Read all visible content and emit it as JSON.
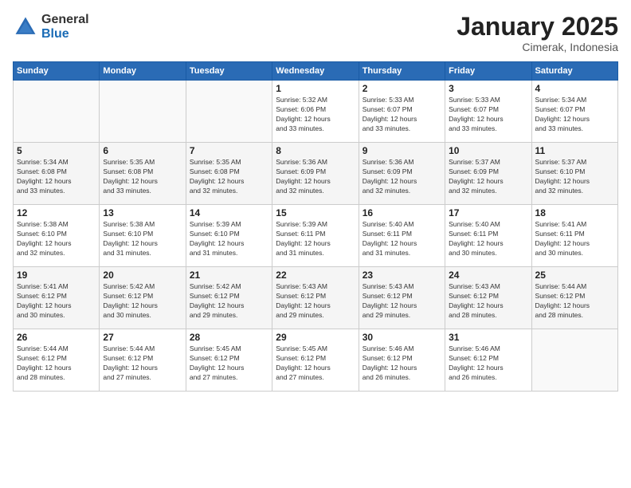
{
  "header": {
    "logo_general": "General",
    "logo_blue": "Blue",
    "month_title": "January 2025",
    "location": "Cimerak, Indonesia"
  },
  "weekdays": [
    "Sunday",
    "Monday",
    "Tuesday",
    "Wednesday",
    "Thursday",
    "Friday",
    "Saturday"
  ],
  "weeks": [
    [
      {
        "day": "",
        "info": ""
      },
      {
        "day": "",
        "info": ""
      },
      {
        "day": "",
        "info": ""
      },
      {
        "day": "1",
        "info": "Sunrise: 5:32 AM\nSunset: 6:06 PM\nDaylight: 12 hours\nand 33 minutes."
      },
      {
        "day": "2",
        "info": "Sunrise: 5:33 AM\nSunset: 6:07 PM\nDaylight: 12 hours\nand 33 minutes."
      },
      {
        "day": "3",
        "info": "Sunrise: 5:33 AM\nSunset: 6:07 PM\nDaylight: 12 hours\nand 33 minutes."
      },
      {
        "day": "4",
        "info": "Sunrise: 5:34 AM\nSunset: 6:07 PM\nDaylight: 12 hours\nand 33 minutes."
      }
    ],
    [
      {
        "day": "5",
        "info": "Sunrise: 5:34 AM\nSunset: 6:08 PM\nDaylight: 12 hours\nand 33 minutes."
      },
      {
        "day": "6",
        "info": "Sunrise: 5:35 AM\nSunset: 6:08 PM\nDaylight: 12 hours\nand 33 minutes."
      },
      {
        "day": "7",
        "info": "Sunrise: 5:35 AM\nSunset: 6:08 PM\nDaylight: 12 hours\nand 32 minutes."
      },
      {
        "day": "8",
        "info": "Sunrise: 5:36 AM\nSunset: 6:09 PM\nDaylight: 12 hours\nand 32 minutes."
      },
      {
        "day": "9",
        "info": "Sunrise: 5:36 AM\nSunset: 6:09 PM\nDaylight: 12 hours\nand 32 minutes."
      },
      {
        "day": "10",
        "info": "Sunrise: 5:37 AM\nSunset: 6:09 PM\nDaylight: 12 hours\nand 32 minutes."
      },
      {
        "day": "11",
        "info": "Sunrise: 5:37 AM\nSunset: 6:10 PM\nDaylight: 12 hours\nand 32 minutes."
      }
    ],
    [
      {
        "day": "12",
        "info": "Sunrise: 5:38 AM\nSunset: 6:10 PM\nDaylight: 12 hours\nand 32 minutes."
      },
      {
        "day": "13",
        "info": "Sunrise: 5:38 AM\nSunset: 6:10 PM\nDaylight: 12 hours\nand 31 minutes."
      },
      {
        "day": "14",
        "info": "Sunrise: 5:39 AM\nSunset: 6:10 PM\nDaylight: 12 hours\nand 31 minutes."
      },
      {
        "day": "15",
        "info": "Sunrise: 5:39 AM\nSunset: 6:11 PM\nDaylight: 12 hours\nand 31 minutes."
      },
      {
        "day": "16",
        "info": "Sunrise: 5:40 AM\nSunset: 6:11 PM\nDaylight: 12 hours\nand 31 minutes."
      },
      {
        "day": "17",
        "info": "Sunrise: 5:40 AM\nSunset: 6:11 PM\nDaylight: 12 hours\nand 30 minutes."
      },
      {
        "day": "18",
        "info": "Sunrise: 5:41 AM\nSunset: 6:11 PM\nDaylight: 12 hours\nand 30 minutes."
      }
    ],
    [
      {
        "day": "19",
        "info": "Sunrise: 5:41 AM\nSunset: 6:12 PM\nDaylight: 12 hours\nand 30 minutes."
      },
      {
        "day": "20",
        "info": "Sunrise: 5:42 AM\nSunset: 6:12 PM\nDaylight: 12 hours\nand 30 minutes."
      },
      {
        "day": "21",
        "info": "Sunrise: 5:42 AM\nSunset: 6:12 PM\nDaylight: 12 hours\nand 29 minutes."
      },
      {
        "day": "22",
        "info": "Sunrise: 5:43 AM\nSunset: 6:12 PM\nDaylight: 12 hours\nand 29 minutes."
      },
      {
        "day": "23",
        "info": "Sunrise: 5:43 AM\nSunset: 6:12 PM\nDaylight: 12 hours\nand 29 minutes."
      },
      {
        "day": "24",
        "info": "Sunrise: 5:43 AM\nSunset: 6:12 PM\nDaylight: 12 hours\nand 28 minutes."
      },
      {
        "day": "25",
        "info": "Sunrise: 5:44 AM\nSunset: 6:12 PM\nDaylight: 12 hours\nand 28 minutes."
      }
    ],
    [
      {
        "day": "26",
        "info": "Sunrise: 5:44 AM\nSunset: 6:12 PM\nDaylight: 12 hours\nand 28 minutes."
      },
      {
        "day": "27",
        "info": "Sunrise: 5:44 AM\nSunset: 6:12 PM\nDaylight: 12 hours\nand 27 minutes."
      },
      {
        "day": "28",
        "info": "Sunrise: 5:45 AM\nSunset: 6:12 PM\nDaylight: 12 hours\nand 27 minutes."
      },
      {
        "day": "29",
        "info": "Sunrise: 5:45 AM\nSunset: 6:12 PM\nDaylight: 12 hours\nand 27 minutes."
      },
      {
        "day": "30",
        "info": "Sunrise: 5:46 AM\nSunset: 6:12 PM\nDaylight: 12 hours\nand 26 minutes."
      },
      {
        "day": "31",
        "info": "Sunrise: 5:46 AM\nSunset: 6:12 PM\nDaylight: 12 hours\nand 26 minutes."
      },
      {
        "day": "",
        "info": ""
      }
    ]
  ]
}
